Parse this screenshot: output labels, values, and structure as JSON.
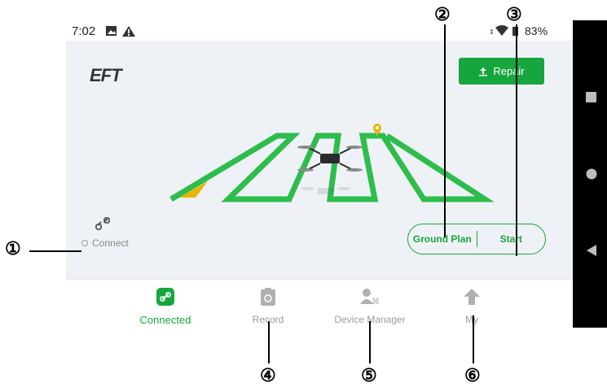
{
  "status_bar": {
    "time": "7:02",
    "battery": "83%",
    "icons": [
      "image-icon",
      "warning-icon",
      "signal-icon",
      "wifi-icon",
      "battery-icon"
    ]
  },
  "app": {
    "logo": "EFT",
    "repair_label": "Repair",
    "connect_label": "Connect",
    "ground_plan_label": "Ground Plan",
    "start_label": "Start",
    "accent_color": "#17a63d"
  },
  "tabs": [
    {
      "label": "Connected",
      "icon": "link-icon",
      "active": true
    },
    {
      "label": "Record",
      "icon": "clipboard-icon",
      "active": false
    },
    {
      "label": "Device Manager",
      "icon": "device-manager-icon",
      "active": false
    },
    {
      "label": "My",
      "icon": "user-icon",
      "active": false
    }
  ],
  "callouts": [
    "①",
    "②",
    "③",
    "④",
    "⑤",
    "⑥"
  ]
}
